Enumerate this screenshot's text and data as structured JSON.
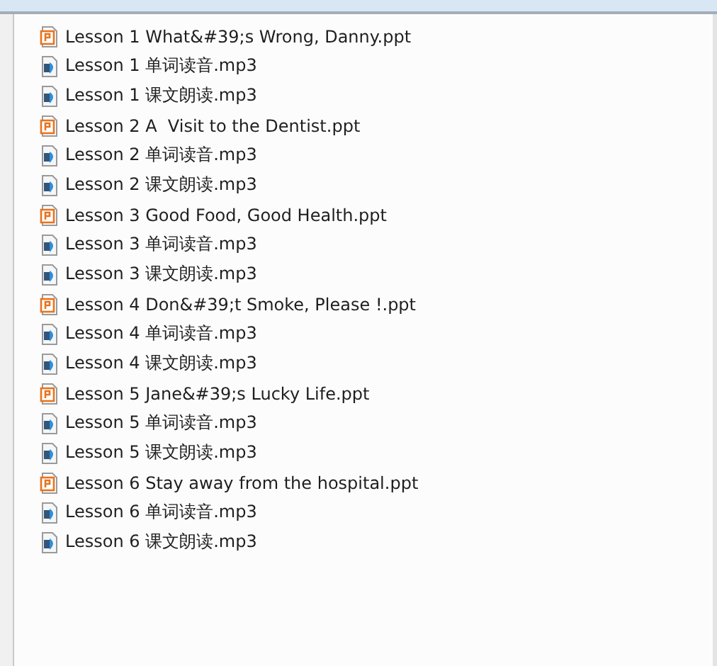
{
  "files": [
    {
      "name": "Lesson 1 What&#39;s Wrong, Danny.ppt",
      "kind": "ppt"
    },
    {
      "name": "Lesson 1 单词读音.mp3",
      "kind": "mp3"
    },
    {
      "name": "Lesson 1 课文朗读.mp3",
      "kind": "mp3"
    },
    {
      "name": "Lesson 2 A  Visit to the Dentist.ppt",
      "kind": "ppt"
    },
    {
      "name": "Lesson 2 单词读音.mp3",
      "kind": "mp3"
    },
    {
      "name": "Lesson 2 课文朗读.mp3",
      "kind": "mp3"
    },
    {
      "name": "Lesson 3 Good Food, Good Health.ppt",
      "kind": "ppt"
    },
    {
      "name": "Lesson 3 单词读音.mp3",
      "kind": "mp3"
    },
    {
      "name": "Lesson 3 课文朗读.mp3",
      "kind": "mp3"
    },
    {
      "name": "Lesson 4 Don&#39;t Smoke, Please !.ppt",
      "kind": "ppt"
    },
    {
      "name": "Lesson 4 单词读音.mp3",
      "kind": "mp3"
    },
    {
      "name": "Lesson 4 课文朗读.mp3",
      "kind": "mp3"
    },
    {
      "name": "Lesson 5 Jane&#39;s Lucky Life.ppt",
      "kind": "ppt"
    },
    {
      "name": "Lesson 5 单词读音.mp3",
      "kind": "mp3"
    },
    {
      "name": "Lesson 5 课文朗读.mp3",
      "kind": "mp3"
    },
    {
      "name": "Lesson 6 Stay away from the hospital.ppt",
      "kind": "ppt"
    },
    {
      "name": "Lesson 6 单词读音.mp3",
      "kind": "mp3"
    },
    {
      "name": "Lesson 6 课文朗读.mp3",
      "kind": "mp3"
    }
  ]
}
